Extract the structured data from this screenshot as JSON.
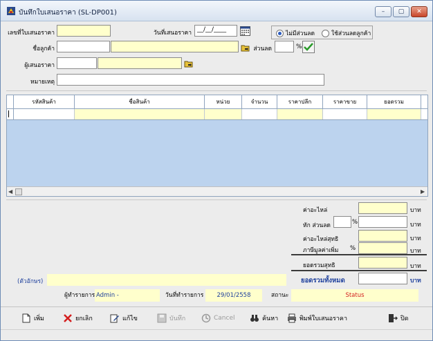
{
  "window": {
    "title": "บันทึกใบเสนอราคา (SL-DP001)",
    "controls": {
      "minimize": "–",
      "maximize": "▢",
      "close": "✕"
    }
  },
  "form": {
    "quote_no_label": "เลขที่ใบเสนอราคา",
    "quote_no_value": "",
    "quote_date_label": "วันที่เสนอราคา",
    "quote_date_value": "__/__/____",
    "customer_label": "ชื่อลูกค้า",
    "customer_code": "",
    "customer_name": "",
    "discount_label": "ส่วนลด",
    "discount_value": "",
    "discount_unit": "%",
    "presenter_label": "ผู้เสนอราคา",
    "presenter_code": "",
    "presenter_name": "",
    "remark_label": "หมายเหตุ",
    "remark_value": "",
    "radio_no_discount": "ไม่มีส่วนลด",
    "radio_customer_discount": "ใช้ส่วนลดลูกค้า",
    "selected_radio": "no_discount"
  },
  "grid": {
    "columns": [
      "รหัสสินค้า",
      "ชื่อสินค้า",
      "หน่วย",
      "จำนวน",
      "ราคาปลีก",
      "ราคาขาย",
      "ยอดรวม"
    ]
  },
  "summary": {
    "cost_label": "ค่าอะไหล่",
    "less_discount_label": "หัก ส่วนลด",
    "net_cost_label": "ค่าอะไหล่สุทธิ",
    "vat_label": "ภาษีมูลค่าเพิ่ม",
    "net_total_label": "ยอดรวมสุทธิ",
    "grand_total_label": "ยอดรวมทั้งหมด",
    "currency": "บาท",
    "percent": "%",
    "amount_in_words_label": "(ตัวอักษร)",
    "amount_in_words": ""
  },
  "status": {
    "user_label": "ผู้ทำรายการ",
    "user_value": "Admin -",
    "date_label": "วันที่ทำรายการ",
    "date_value": "29/01/2558",
    "state_label": "สถานะ",
    "state_value": "Status"
  },
  "toolbar": {
    "add": "เพิ่ม",
    "cancel": "ยกเลิก",
    "edit": "แก้ไข",
    "save": "บันทึก",
    "void": "Cancel",
    "search": "ค้นหา",
    "print": "พิมพ์ใบเสนอราคา",
    "close": "ปิด"
  },
  "colors": {
    "input_yellow": "#ffffcc",
    "grid_blue": "#bcd3ee",
    "link_blue": "#1d3f9c",
    "status_red": "#d42020",
    "check_green": "#2a9a2a"
  },
  "icons": [
    "app-icon",
    "calendar-icon",
    "search-customer-icon",
    "search-presenter-icon",
    "confirm-check-icon",
    "add-doc-icon",
    "cancel-x-icon",
    "edit-icon",
    "save-icon",
    "void-icon",
    "binoculars-icon",
    "printer-icon",
    "exit-icon"
  ]
}
